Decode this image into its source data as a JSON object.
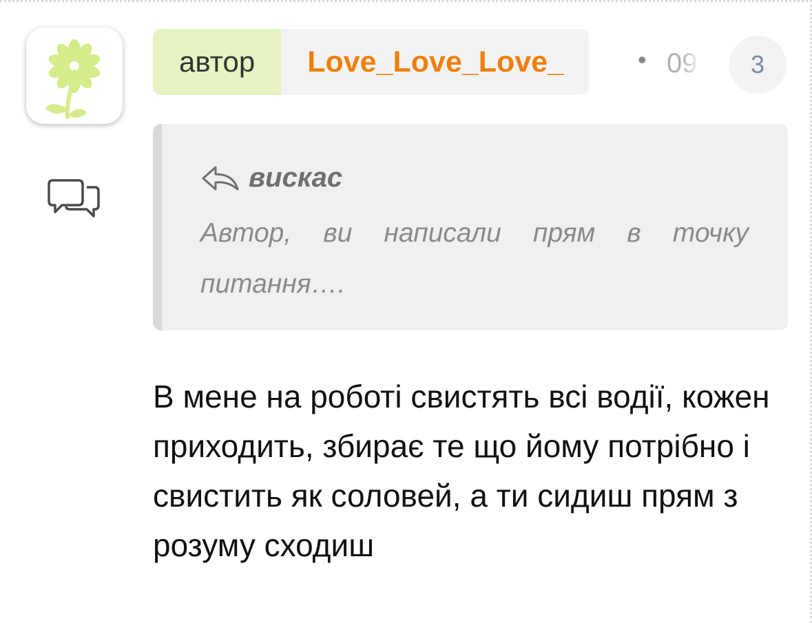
{
  "comment": {
    "author_label": "автор",
    "author_name": "Love_Love_Love_",
    "meta_separator": "•",
    "date_partial": "09",
    "reply_count": "3",
    "quote": {
      "author": "вискас",
      "text": "Автор, ви написали прям в точку питання…."
    },
    "body": "В мене на роботі свистять всі водії, кожен приходить, збирає те що йому потрібно і свистить як соловей, а ти сидиш прям з розуму сходиш"
  },
  "icons": {
    "avatar": "flower-logo-icon",
    "reply": "chat-bubbles-icon",
    "quote_reply": "reply-arrow-icon"
  },
  "colors": {
    "author_label_bg": "#e6f3c2",
    "author_name": "#f07f0b",
    "pill_bg": "#f3f3f3",
    "quote_bg": "#f0f0f0",
    "quote_border": "#d9d9d9",
    "flower_green": "#d4ec8a"
  }
}
